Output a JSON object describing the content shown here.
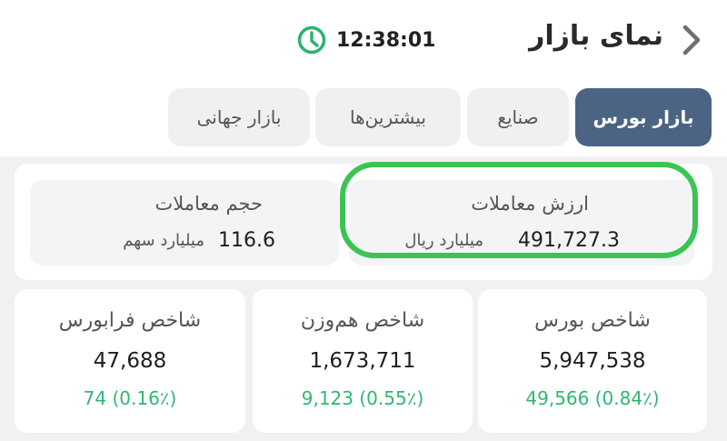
{
  "header": {
    "title": "نمای بازار",
    "time": "12:38:01",
    "clock_icon": "clock-icon",
    "back_icon": "chevron-right-icon"
  },
  "tabs": [
    {
      "label": "بازار بورس",
      "active": true
    },
    {
      "label": "صنایع",
      "active": false
    },
    {
      "label": "بیشترین‌ها",
      "active": false
    },
    {
      "label": "بازار جهانی",
      "active": false
    }
  ],
  "summary": {
    "trade_value": {
      "title": "ارزش معاملات",
      "value": "491,727.3",
      "unit": "میلیارد ریال"
    },
    "trade_volume": {
      "title": "حجم معاملات",
      "value": "116.6",
      "unit": "میلیارد سهم"
    }
  },
  "indices": [
    {
      "title": "شاخص بورس",
      "value": "5,947,538",
      "change": "49,566 (0.84٪)"
    },
    {
      "title": "شاخص هم‌وزن",
      "value": "1,673,711",
      "change": "9,123 (0.55٪)"
    },
    {
      "title": "شاخص فرابورس",
      "value": "47,688",
      "change": "74 (0.16٪)"
    }
  ],
  "colors": {
    "accent_tab": "#4b6484",
    "positive": "#2eb872",
    "highlight": "#3bc453",
    "clock": "#2cb36b"
  }
}
